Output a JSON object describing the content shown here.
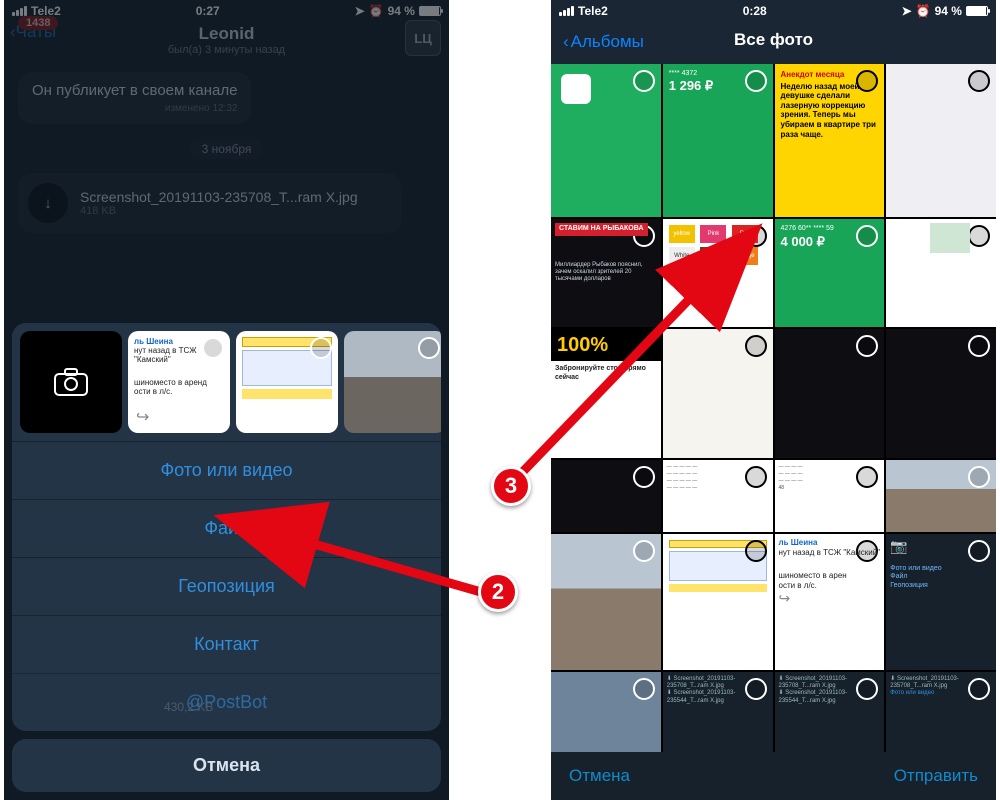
{
  "status": {
    "carrier": "Tele2",
    "time_left": "0:27",
    "time_right": "0:28",
    "battery_pct": "94 %"
  },
  "left": {
    "back_label": "Чаты",
    "unread_badge": "1438",
    "title": "Leonid",
    "subtitle": "был(а) 3 минуты назад",
    "avatar_initials": "LЦ",
    "message_text": "Он публикует в своем канале",
    "message_edited": "изменено 12:32",
    "date_divider": "3 ноября",
    "file_name": "Screenshot_20191103-235708_T...ram X.jpg",
    "file_size": "418 KB",
    "hidden_size": "430,2 KB",
    "menu": {
      "photo_video": "Фото или видео",
      "file": "Файл",
      "location": "Геопозиция",
      "contact": "Контакт",
      "postbot": "@PostBot"
    },
    "cancel": "Отмена",
    "thumb_doc": {
      "l1": "ль Шеина",
      "l2": "нут назад в ТСЖ \"Камский\"",
      "l3": "шиноместо в аренд",
      "l4": "ости в л/с."
    }
  },
  "right": {
    "back_label": "Альбомы",
    "title": "Все фото",
    "footer_cancel": "Отмена",
    "footer_send": "Отправить",
    "cells": {
      "green_receipt": {
        "amount": "1 296 ₽",
        "card": "**** 4372"
      },
      "yellow_joke": {
        "head": "Анекдот месяца",
        "body": "Неделю назад моей девушке сделали лазерную коррекцию зрения. Теперь мы убираем в квартире три раза чаще."
      },
      "green_receipt2": {
        "amount": "4 000 ₽",
        "card": "4276 60** **** 59"
      },
      "hundred": "100%",
      "promo_line": "Забронируйте стол прямо сейчас",
      "sheet_doc": {
        "l1": "ль Шеина",
        "l2": "нут назад в ТСЖ \"Камский\"",
        "l3": "шиноместо в арен",
        "l4": "ости в л/с."
      },
      "teleg_items": {
        "a": "Фото или видео",
        "b": "Файл",
        "c": "Геопозиция"
      },
      "shot_label": "Screenshot_20191103-235708_T...ram X.jpg",
      "shot_label2": "Screenshot_20191103-235544_T...ram X.jpg",
      "swatches": {
        "yellow": "yellow",
        "pink": "Pink",
        "red": "Red",
        "white": "White",
        "brown": "Brown",
        "orange": "orange"
      },
      "stavim": "СТАВИМ НА РЫБАКОВА",
      "stavim_sub": "Миллиардер Рыбаков пояснил, зачем оскалил зрителей 20 тысячами долларов"
    }
  },
  "callouts": {
    "n2": "2",
    "n3": "3"
  }
}
